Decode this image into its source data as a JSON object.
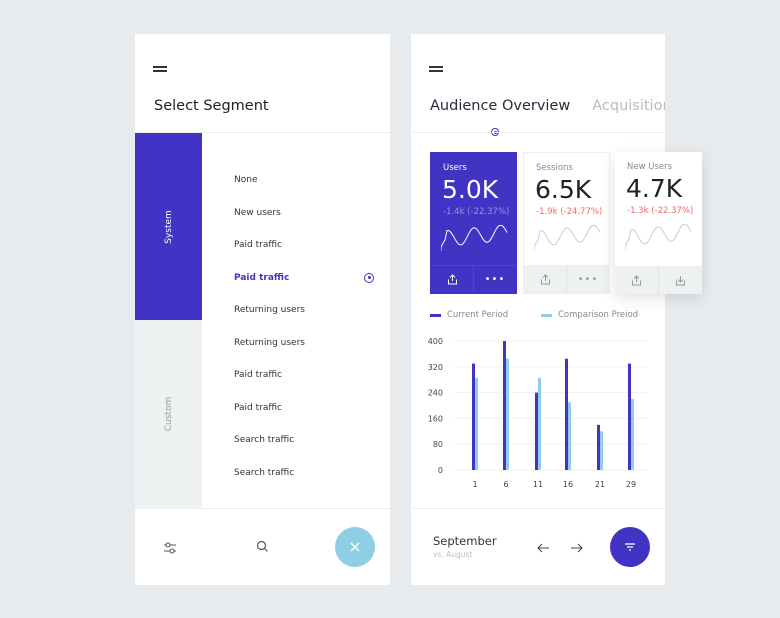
{
  "left": {
    "title": "Select Segment",
    "tabs": {
      "system": "System",
      "custom": "Custom"
    },
    "items": [
      {
        "label": "None"
      },
      {
        "label": "New users"
      },
      {
        "label": "Paid traffic"
      },
      {
        "label": "Paid traffic",
        "selected": true
      },
      {
        "label": "Returning users"
      },
      {
        "label": "Returning users"
      },
      {
        "label": "Paid traffic"
      },
      {
        "label": "Paid traffic"
      },
      {
        "label": "Search traffic"
      },
      {
        "label": "Search traffic"
      }
    ],
    "bottom": {
      "icons": [
        "sliders-icon",
        "search-icon",
        "close-icon"
      ],
      "fab_color": "#8ecfe6"
    }
  },
  "right": {
    "tabs": [
      "Audience Overview",
      "Acquisition C"
    ],
    "cards": [
      {
        "label": "Users",
        "value": "5.0K",
        "change": "-1.4k (-22.37%)",
        "actions": [
          "share-icon",
          "more-icon"
        ]
      },
      {
        "label": "Sessions",
        "value": "6.5K",
        "change": "-1.9k (-24.77%)",
        "actions": [
          "share-icon",
          "more-icon"
        ]
      },
      {
        "label": "New Users",
        "value": "4.7K",
        "change": "-1.3k (-22.37%)",
        "actions": [
          "share-icon",
          "download-icon"
        ]
      }
    ],
    "footer": {
      "month": "September",
      "compare": "vs. August",
      "fab_color": "#4133c4"
    }
  },
  "colors": {
    "accent": "#4133c4",
    "comparison": "#8ecfe6",
    "negative": "#f06a6a"
  },
  "chart_data": {
    "type": "bar",
    "categories": [
      "1",
      "6",
      "11",
      "16",
      "21",
      "29"
    ],
    "series": [
      {
        "name": "Current Period",
        "color": "#4133c4",
        "values": [
          330,
          400,
          240,
          345,
          140,
          330
        ]
      },
      {
        "name": "Comparison Preiod",
        "color": "#8ecfe6",
        "values": [
          285,
          345,
          285,
          210,
          120,
          220
        ]
      }
    ],
    "yticks": [
      0,
      80,
      160,
      240,
      320,
      400
    ],
    "ylim": [
      0,
      400
    ],
    "grid": true,
    "legend": "top"
  }
}
